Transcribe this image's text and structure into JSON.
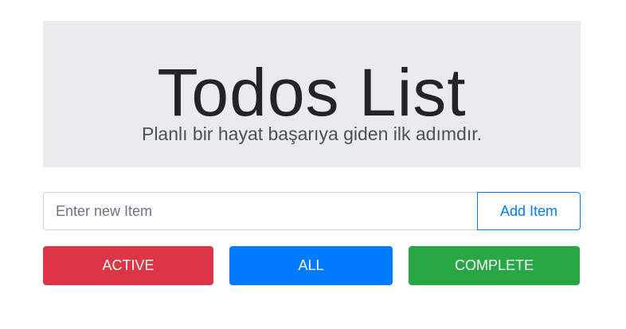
{
  "header": {
    "title": "Todos List",
    "subtitle": "Planlı bir hayat başarıya giden ilk adımdır."
  },
  "new_item": {
    "placeholder": "Enter new Item",
    "value": "",
    "add_label": "Add Item"
  },
  "filters": {
    "active_label": "ACTIVE",
    "all_label": "ALL",
    "complete_label": "COMPLETE"
  },
  "colors": {
    "jumbotron_bg": "#e9ecef",
    "primary": "#007bff",
    "danger": "#dc3545",
    "success": "#28a745"
  }
}
